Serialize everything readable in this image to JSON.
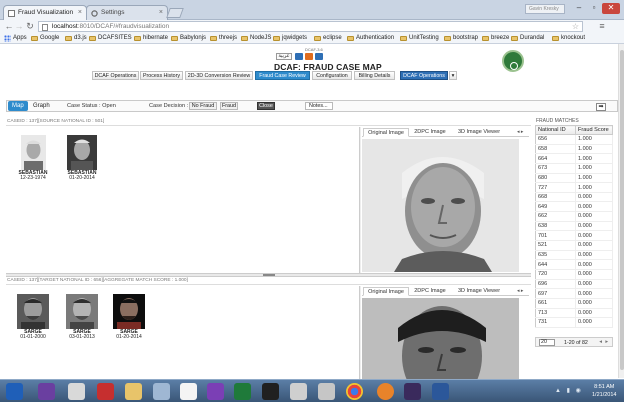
{
  "browser": {
    "tabs": [
      {
        "label": "Fraud Visualization",
        "active": true
      },
      {
        "label": "Settings",
        "active": false
      }
    ],
    "url_host": "localhost",
    "url_path": ":8010/DCAF/#fraudvisualization",
    "user_box": "Gavin Kresky",
    "bookmarks": [
      "Apps",
      "Google",
      "d3.js",
      "DCAFSITES",
      "hibernate",
      "Babylonjs",
      "threejs",
      "NodeJS",
      "jqwidgets",
      "eclipse",
      "Authentication",
      "UnitTesting",
      "bootstrap",
      "breeze",
      "Durandal",
      "knockout"
    ]
  },
  "header": {
    "brand_small": "DCAF-3.6",
    "lang_button": "عربية",
    "title": "DCAF: FRAUD CASE MAP",
    "menu": [
      {
        "label": "DCAF Operations",
        "active": false
      },
      {
        "label": "Process History",
        "active": false
      },
      {
        "label": "2D-3D Conversion Review",
        "active": false
      },
      {
        "label": "Fraud Case Review",
        "active": true
      },
      {
        "label": "Configuration",
        "active": false
      },
      {
        "label": "Billing Details",
        "active": false
      },
      {
        "label": "DCAF Operations",
        "active": false,
        "dropdown": true
      }
    ],
    "colors": {
      "accent": "#2e8bcc",
      "dcaf_blue": "#2e6fb5"
    }
  },
  "toolbar": {
    "tabs": [
      {
        "label": "Map",
        "selected": true
      },
      {
        "label": "Graph",
        "selected": false
      }
    ],
    "case_status": "Case Status : Open",
    "case_decision": "Case Decision :",
    "no_fraud": "No Fraud",
    "fraud": "Fraud",
    "close": "Close",
    "notes": "Notes...",
    "arrow_icon": "arrow-right-icon"
  },
  "source_case": {
    "header": "CASEID : 137][SOURCE NATIONAL ID : 501]",
    "people": [
      {
        "name": "SEBASTIAN",
        "date": "12-23-1974"
      },
      {
        "name": "SEBASTIAN",
        "date": "01-20-2014"
      }
    ],
    "viewer_tabs": [
      "Original Image",
      "2DPC Image",
      "3D Image Viewer"
    ]
  },
  "target_case": {
    "header": "CASEID : 137][TARGET NATIONAL ID : 656][AGGREGATE MATCH SCORE : 1.000]",
    "people": [
      {
        "name": "SARGE",
        "date": "01-01-2000"
      },
      {
        "name": "SARGE",
        "date": "03-01-2013"
      },
      {
        "name": "SARGE",
        "date": "01-20-2014"
      }
    ],
    "viewer_tabs": [
      "Original Image",
      "2DPC Image",
      "3D Image Viewer"
    ]
  },
  "fraud_matches": {
    "title": "FRAUD MATCHES",
    "columns": [
      "National ID",
      "Fraud Score"
    ],
    "rows": [
      [
        "656",
        "1.000"
      ],
      [
        "658",
        "1.000"
      ],
      [
        "664",
        "1.000"
      ],
      [
        "673",
        "1.000"
      ],
      [
        "680",
        "1.000"
      ],
      [
        "727",
        "1.000"
      ],
      [
        "668",
        "0.000"
      ],
      [
        "649",
        "0.000"
      ],
      [
        "662",
        "0.000"
      ],
      [
        "638",
        "0.000"
      ],
      [
        "701",
        "0.000"
      ],
      [
        "521",
        "0.000"
      ],
      [
        "635",
        "0.000"
      ],
      [
        "644",
        "0.000"
      ],
      [
        "720",
        "0.000"
      ],
      [
        "696",
        "0.000"
      ],
      [
        "697",
        "0.000"
      ],
      [
        "661",
        "0.000"
      ],
      [
        "713",
        "0.000"
      ],
      [
        "731",
        "0.000"
      ]
    ],
    "page_size": "20",
    "pager_text": "1-20 of 82"
  },
  "taskbar": {
    "icons": [
      "outlook-icon",
      "visual-studio-icon",
      "media-icon",
      "ccleaner-icon",
      "folder-icon",
      "desktop-icon",
      "file-icon",
      "visual-studio-purple-icon",
      "excel-icon",
      "command-prompt-icon",
      "tools-icon",
      "chrome-icon",
      "firefox-icon",
      "eclipse-icon",
      "word-icon"
    ],
    "time": "8:51 AM",
    "date": "1/21/2014"
  }
}
